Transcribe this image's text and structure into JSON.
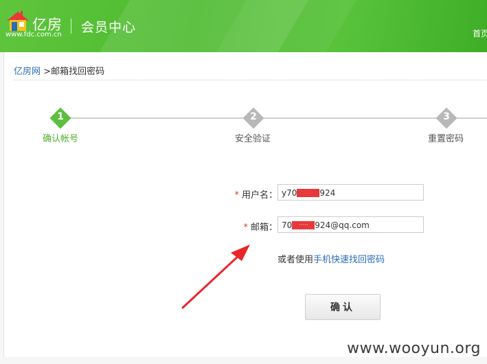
{
  "header": {
    "logo_text": "亿房",
    "logo_url": "www.fdc.com.cn",
    "section_title": "会员中心",
    "nav_home": "首页"
  },
  "breadcrumb": {
    "home_link": "亿房网",
    "separator": ">",
    "current": "邮箱找回密码"
  },
  "steps": [
    {
      "number": "1",
      "label": "确认帐号",
      "state": "active"
    },
    {
      "number": "2",
      "label": "安全验证",
      "state": "inactive"
    },
    {
      "number": "3",
      "label": "重置密码",
      "state": "inactive"
    }
  ],
  "colors": {
    "brand_green": "#4cba2f",
    "step_active": "#5cbf3f",
    "step_inactive": "#b8b8b8",
    "link_blue": "#2a6cb5",
    "required_red": "#e23b2e",
    "redaction_red": "#e8383a",
    "arrow_red": "#e8272a"
  },
  "form": {
    "required_mark": "*",
    "username_label": "用户名：",
    "username_prefix": "y70",
    "username_suffix": "924",
    "email_label": "邮箱：",
    "email_prefix": "70",
    "email_mask": "·····",
    "email_suffix": "924@qq.com",
    "alt_prefix": "或者使用",
    "alt_link": "手机快速找回密码",
    "confirm_label": "确认"
  },
  "watermark": "www.wooyun.org"
}
